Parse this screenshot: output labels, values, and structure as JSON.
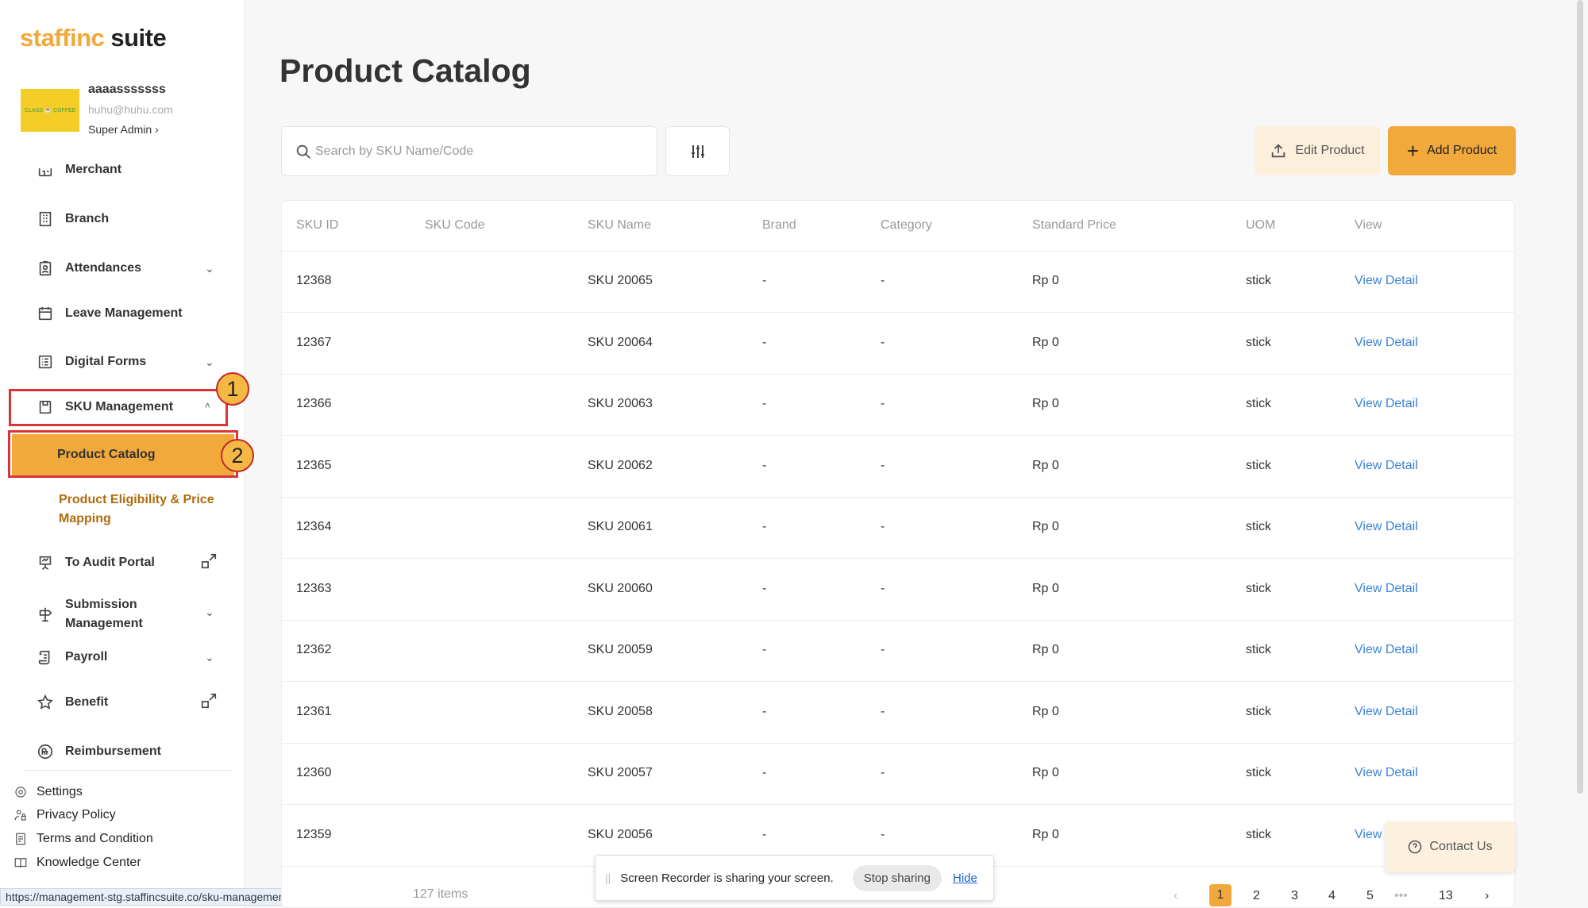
{
  "brand": {
    "logo_part1": "staffinc",
    "logo_part2": " suite",
    "accent": "#f2a93b"
  },
  "profile": {
    "name": "aaaasssssss",
    "email": "huhu@huhu.com",
    "role": "Super Admin ›",
    "avatar_text": "CLASS ☕ COFFEE"
  },
  "sidebar": {
    "items": [
      {
        "label": "Merchant"
      },
      {
        "label": "Branch"
      },
      {
        "label": "Attendances"
      },
      {
        "label": "Leave Management"
      },
      {
        "label": "Digital Forms"
      },
      {
        "label": "SKU Management"
      },
      {
        "label": "Product Catalog"
      },
      {
        "label": "Product Eligibility & Price Mapping"
      },
      {
        "label": "To Audit Portal"
      },
      {
        "label": "Submission Management"
      },
      {
        "label": "Payroll"
      },
      {
        "label": "Benefit"
      },
      {
        "label": "Reimbursement"
      }
    ],
    "footer": [
      {
        "label": "Settings"
      },
      {
        "label": "Privacy Policy"
      },
      {
        "label": "Terms and Condition"
      },
      {
        "label": "Knowledge Center"
      }
    ]
  },
  "annotations": {
    "marker1": "1",
    "marker2": "2"
  },
  "status_url": "https://management-stg.staffincsuite.co/sku-management/product-catalog",
  "main": {
    "title": "Product Catalog",
    "search_placeholder": "Search by SKU Name/Code",
    "edit_label": "Edit Product",
    "add_label": "Add Product"
  },
  "table": {
    "headers": [
      "SKU ID",
      "SKU Code",
      "SKU Name",
      "Brand",
      "Category",
      "Standard Price",
      "UOM",
      "View"
    ],
    "rows": [
      {
        "id": "12368",
        "code": "",
        "name": "SKU 20065",
        "brand": "-",
        "category": "-",
        "price": "Rp 0",
        "uom": "stick",
        "view": "View Detail"
      },
      {
        "id": "12367",
        "code": "",
        "name": "SKU 20064",
        "brand": "-",
        "category": "-",
        "price": "Rp 0",
        "uom": "stick",
        "view": "View Detail"
      },
      {
        "id": "12366",
        "code": "",
        "name": "SKU 20063",
        "brand": "-",
        "category": "-",
        "price": "Rp 0",
        "uom": "stick",
        "view": "View Detail"
      },
      {
        "id": "12365",
        "code": "",
        "name": "SKU 20062",
        "brand": "-",
        "category": "-",
        "price": "Rp 0",
        "uom": "stick",
        "view": "View Detail"
      },
      {
        "id": "12364",
        "code": "",
        "name": "SKU 20061",
        "brand": "-",
        "category": "-",
        "price": "Rp 0",
        "uom": "stick",
        "view": "View Detail"
      },
      {
        "id": "12363",
        "code": "",
        "name": "SKU 20060",
        "brand": "-",
        "category": "-",
        "price": "Rp 0",
        "uom": "stick",
        "view": "View Detail"
      },
      {
        "id": "12362",
        "code": "",
        "name": "SKU 20059",
        "brand": "-",
        "category": "-",
        "price": "Rp 0",
        "uom": "stick",
        "view": "View Detail"
      },
      {
        "id": "12361",
        "code": "",
        "name": "SKU 20058",
        "brand": "-",
        "category": "-",
        "price": "Rp 0",
        "uom": "stick",
        "view": "View Detail"
      },
      {
        "id": "12360",
        "code": "",
        "name": "SKU 20057",
        "brand": "-",
        "category": "-",
        "price": "Rp 0",
        "uom": "stick",
        "view": "View Detail"
      },
      {
        "id": "12359",
        "code": "",
        "name": "SKU 20056",
        "brand": "-",
        "category": "-",
        "price": "Rp 0",
        "uom": "stick",
        "view": "View"
      }
    ]
  },
  "footer_bar": {
    "items_text": "127 items",
    "pages": [
      "1",
      "2",
      "3",
      "4",
      "5",
      "•••",
      "13"
    ],
    "prev": "‹",
    "next": "›"
  },
  "recorder": {
    "message": "Screen Recorder is sharing your screen.",
    "stop_label": "Stop sharing",
    "hide_label": "Hide"
  },
  "contact_label": "Contact Us"
}
